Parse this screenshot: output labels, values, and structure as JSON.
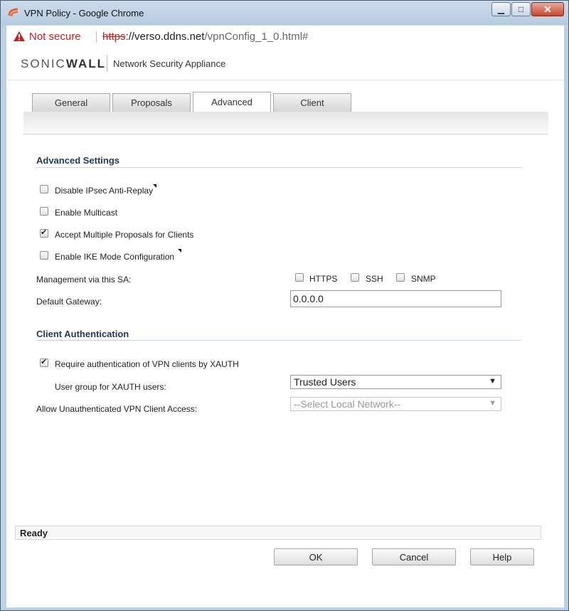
{
  "window": {
    "title": "VPN Policy - Google Chrome"
  },
  "address_bar": {
    "security_label": "Not secure",
    "url_scheme": "https",
    "url_host": "://verso.ddns.net",
    "url_path": "/vpnConfig_1_0.html#"
  },
  "brand": {
    "logo_text": "SONIC",
    "logo_accent": "WALL",
    "product": "Network Security Appliance"
  },
  "tabs": [
    {
      "label": "General"
    },
    {
      "label": "Proposals"
    },
    {
      "label": "Advanced",
      "active": true
    },
    {
      "label": "Client"
    }
  ],
  "advanced": {
    "title": "Advanced Settings",
    "options": [
      {
        "label": "Disable IPsec Anti-Replay",
        "checked": false
      },
      {
        "label": "Enable Multicast",
        "checked": false
      },
      {
        "label": "Accept Multiple Proposals for Clients",
        "checked": true
      },
      {
        "label": "Enable IKE Mode Configuration",
        "checked": false
      }
    ],
    "management_label": "Management via this SA:",
    "management_options": [
      {
        "label": "HTTPS",
        "checked": false
      },
      {
        "label": "SSH",
        "checked": false
      },
      {
        "label": "SNMP",
        "checked": false
      }
    ],
    "gateway_label": "Default Gateway:",
    "gateway_value": "0.0.0.0"
  },
  "client_auth": {
    "title": "Client Authentication",
    "xauth_label": "Require authentication of VPN clients by XAUTH",
    "xauth_checked": true,
    "user_group_label": "User group for XAUTH users:",
    "user_group_value": "Trusted Users",
    "unauth_label": "Allow Unauthenticated VPN Client Access:",
    "unauth_value": "--Select Local Network--"
  },
  "status": {
    "text": "Ready"
  },
  "buttons": {
    "ok": "OK",
    "cancel": "Cancel",
    "help": "Help"
  },
  "colors": {
    "accent": "#1f3a5a",
    "warning": "#c5221f",
    "brand_orange": "#e8642c"
  }
}
